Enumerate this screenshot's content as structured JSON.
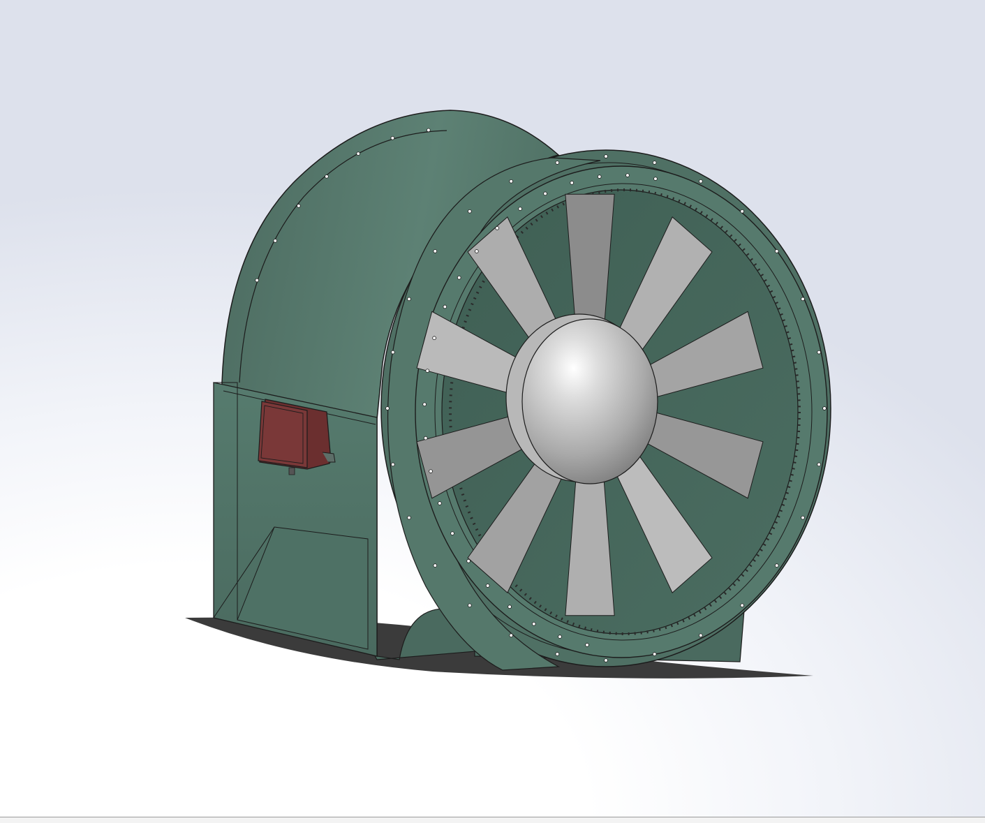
{
  "viewport": {
    "view_label": "",
    "background_colors": [
      "#ffffff",
      "#f2f4f9",
      "#dde1ec"
    ]
  },
  "model": {
    "part": "axial-fan-assembly",
    "blade_count": 10,
    "colors": {
      "housing": "#4f6e63",
      "housing_light": "#5c8073",
      "housing_dark": "#3d574d",
      "interior": "#45675b",
      "blade": "#9c9c9c",
      "hub": "#c8c8c8",
      "terminal_box": "#7a3535",
      "shadow": "#3a3a3a",
      "edge": "#1c1c1c"
    }
  },
  "status_bar": {
    "text": ""
  }
}
